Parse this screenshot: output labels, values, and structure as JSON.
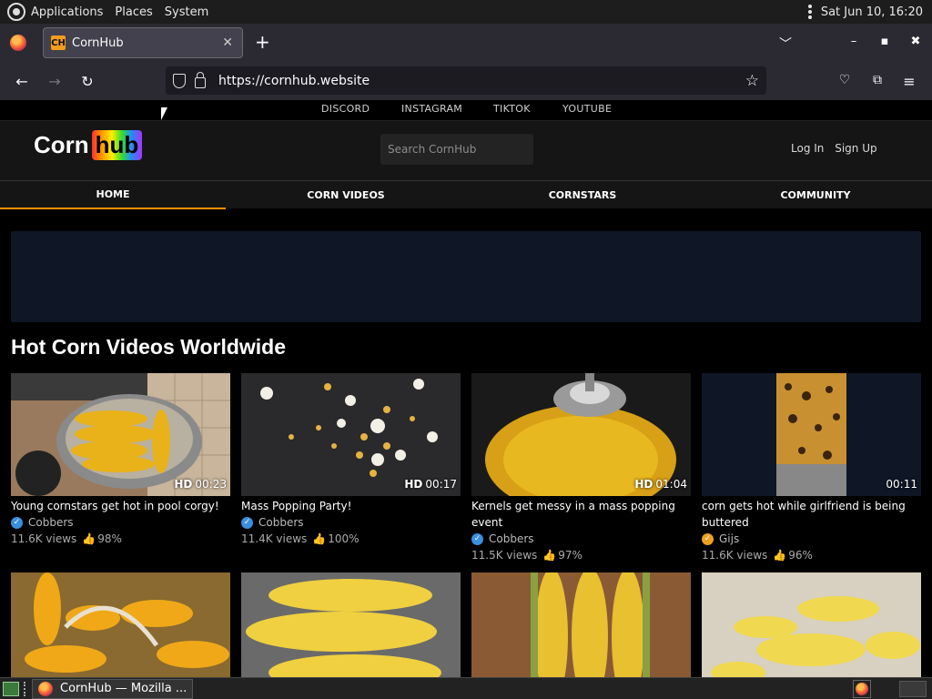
{
  "gnome_panel": {
    "menus": [
      "Applications",
      "Places",
      "System"
    ],
    "clock": "Sat Jun 10, 16:20"
  },
  "browser": {
    "tab_title": "CornHub",
    "tab_favicon_text": "CH",
    "url": "https://cornhub.website",
    "window_title_taskbar": "CornHub — Mozilla ..."
  },
  "site": {
    "social_links": [
      "DISCORD",
      "INSTAGRAM",
      "TIKTOK",
      "YOUTUBE"
    ],
    "logo_left": "Corn",
    "logo_right": "hub",
    "search_placeholder": "Search CornHub",
    "login": "Log In",
    "signup": "Sign Up",
    "nav": [
      "HOME",
      "CORN VIDEOS",
      "CORNSTARS",
      "COMMUNITY"
    ],
    "active_nav": "HOME",
    "section_title": "Hot Corn Videos Worldwide",
    "accent_color": "#ff9000"
  },
  "videos": [
    {
      "title": "Young cornstars get hot in pool corgy!",
      "channel": "Cobbers",
      "views": "11.6K views",
      "rating": "98%",
      "hd": "HD",
      "duration": "00:23",
      "badge": "verified"
    },
    {
      "title": "Mass Popping Party!",
      "channel": "Cobbers",
      "views": "11.4K views",
      "rating": "100%",
      "hd": "HD",
      "duration": "00:17",
      "badge": "verified"
    },
    {
      "title": "Kernels get messy in a mass popping event",
      "channel": "Cobbers",
      "views": "11.5K views",
      "rating": "97%",
      "hd": "HD",
      "duration": "01:04",
      "badge": "verified"
    },
    {
      "title": "corn gets hot while girlfriend is being buttered",
      "channel": "Gijs",
      "views": "11.6K views",
      "rating": "96%",
      "hd": "",
      "duration": "00:11",
      "badge": "gold"
    }
  ]
}
